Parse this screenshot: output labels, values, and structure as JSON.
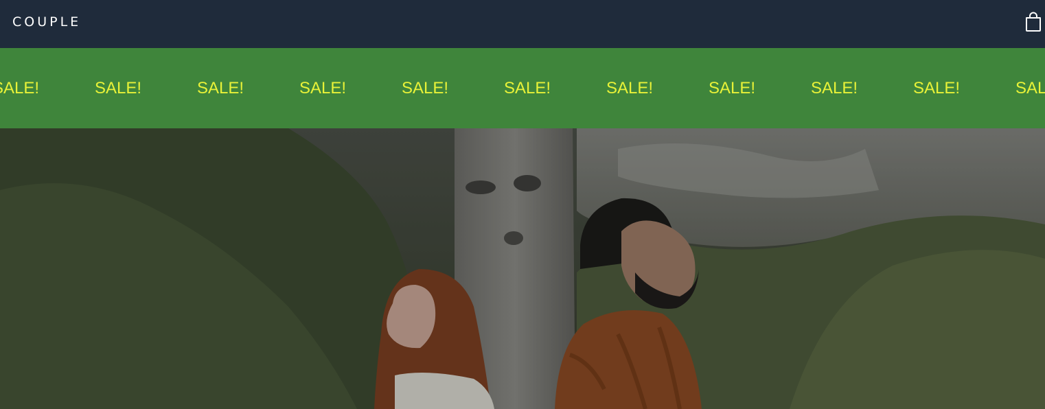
{
  "header": {
    "brand": "COUPLE",
    "cart_icon": "shopping-bag-icon"
  },
  "sale_banner": {
    "items": [
      "SALE!",
      "SALE!",
      "SALE!",
      "SALE!",
      "SALE!",
      "SALE!",
      "SALE!",
      "SALE!",
      "SALE!",
      "SALE!",
      "SALE!"
    ],
    "background": "#3f853b",
    "text_color": "#e8f238"
  },
  "colors": {
    "header_bg": "#1f2b3b",
    "header_text": "#ffffff"
  }
}
